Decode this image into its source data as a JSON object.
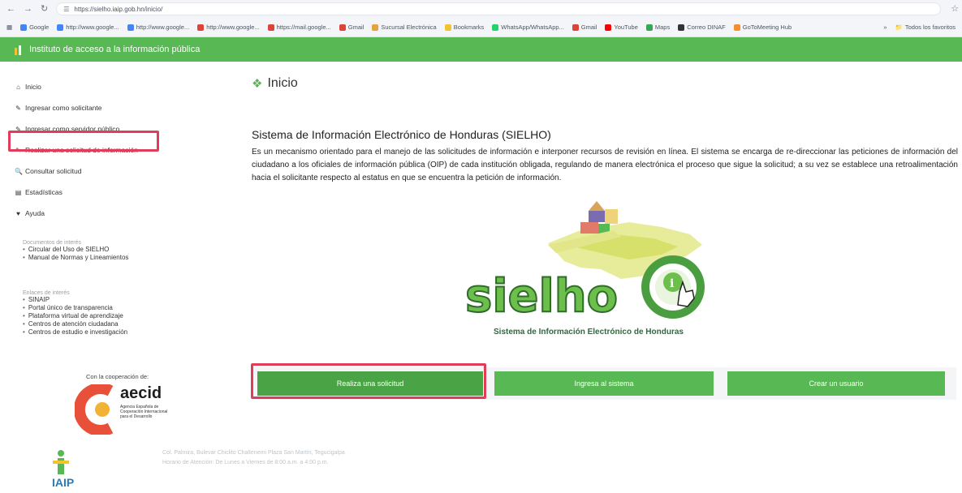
{
  "browser": {
    "url": "https://sielho.iaip.gob.hn/inicio/",
    "bookmarks": [
      {
        "label": "Google",
        "color": "#4285f4"
      },
      {
        "label": "http://www.google...",
        "color": "#4285f4"
      },
      {
        "label": "http://www.google...",
        "color": "#4285f4"
      },
      {
        "label": "http://www.google...",
        "color": "#db4437"
      },
      {
        "label": "https://mail.google...",
        "color": "#db4437"
      },
      {
        "label": "Gmail",
        "color": "#db4437"
      },
      {
        "label": "Sucursal Electrónica",
        "color": "#e6a23c"
      },
      {
        "label": "Bookmarks",
        "color": "#f2c230"
      },
      {
        "label": "WhatsApp/WhatsApp...",
        "color": "#25d366"
      },
      {
        "label": "Gmail",
        "color": "#db4437"
      },
      {
        "label": "YouTube",
        "color": "#ff0000"
      },
      {
        "label": "Maps",
        "color": "#34a853"
      },
      {
        "label": "Correo DINAF",
        "color": "#333333"
      },
      {
        "label": "GoToMeeting Hub",
        "color": "#f68d2e"
      }
    ],
    "all_bookmarks": "Todos los favoritos"
  },
  "header": {
    "title": "Instituto de acceso a la información pública"
  },
  "sidebar": {
    "menu": [
      {
        "label": "Inicio",
        "icon": "home-icon"
      },
      {
        "label": "Ingresar como solicitante",
        "icon": "edit-icon"
      },
      {
        "label": "Ingresar como servidor público",
        "icon": "edit-icon"
      },
      {
        "label": "Realizar una solicitud de información",
        "icon": "edit-icon"
      },
      {
        "label": "Consultar solicitud",
        "icon": "search-icon"
      },
      {
        "label": "Estadísticas",
        "icon": "chart-icon"
      },
      {
        "label": "Ayuda",
        "icon": "heart-icon"
      }
    ],
    "documents": {
      "title": "Documentos de interés",
      "items": [
        "Circular del Uso de SIELHO",
        "Manual de Normas y Lineamientos"
      ]
    },
    "links": {
      "title": "Enlaces de interés",
      "items": [
        "SINAIP",
        "Portal único de transparencia",
        "Plataforma virtual de aprendizaje",
        "Centros de atención ciudadana",
        "Centros de estudio e investigación"
      ]
    },
    "cooperation": "Con la cooperación de:",
    "aecid": {
      "word": "aecid",
      "subtitle": "Agencia Española de Cooperación Internacional para el Desarrollo"
    },
    "iaip": "IAIP"
  },
  "main": {
    "title": "Inicio",
    "system_title": "Sistema de Información Electrónico de Honduras (SIELHO)",
    "description": "Es un mecanismo orientado para el manejo de las solicitudes de información e interponer recursos de revisión en línea. El sistema se encarga de re-direccionar las peticiones de información del ciudadano a los oficiales de información pública (OIP) de cada institución obligada, regulando de manera electrónica el proceso que sigue la solicitud; a su vez se establece una retroalimentación hacia el solicitante respecto al estatus en que se encuentra la petición de información.",
    "logo_word": "sielho",
    "logo_caption": "Sistema de Información Electrónico de Honduras",
    "buttons": {
      "request": "Realiza una solicitud",
      "login": "Ingresa al sistema",
      "create": "Crear un usuario"
    },
    "footer": {
      "line1": "Col. Palmira, Bulevar Chiclito Chaltenemi Plaza San Martín, Tegucigalpa",
      "line2": "Horario de Atención: De Lunes a Viernes de 8:00 a.m. a 4:00 p.m."
    }
  },
  "colors": {
    "brand_green": "#58b853",
    "highlight": "#e23c5b"
  }
}
